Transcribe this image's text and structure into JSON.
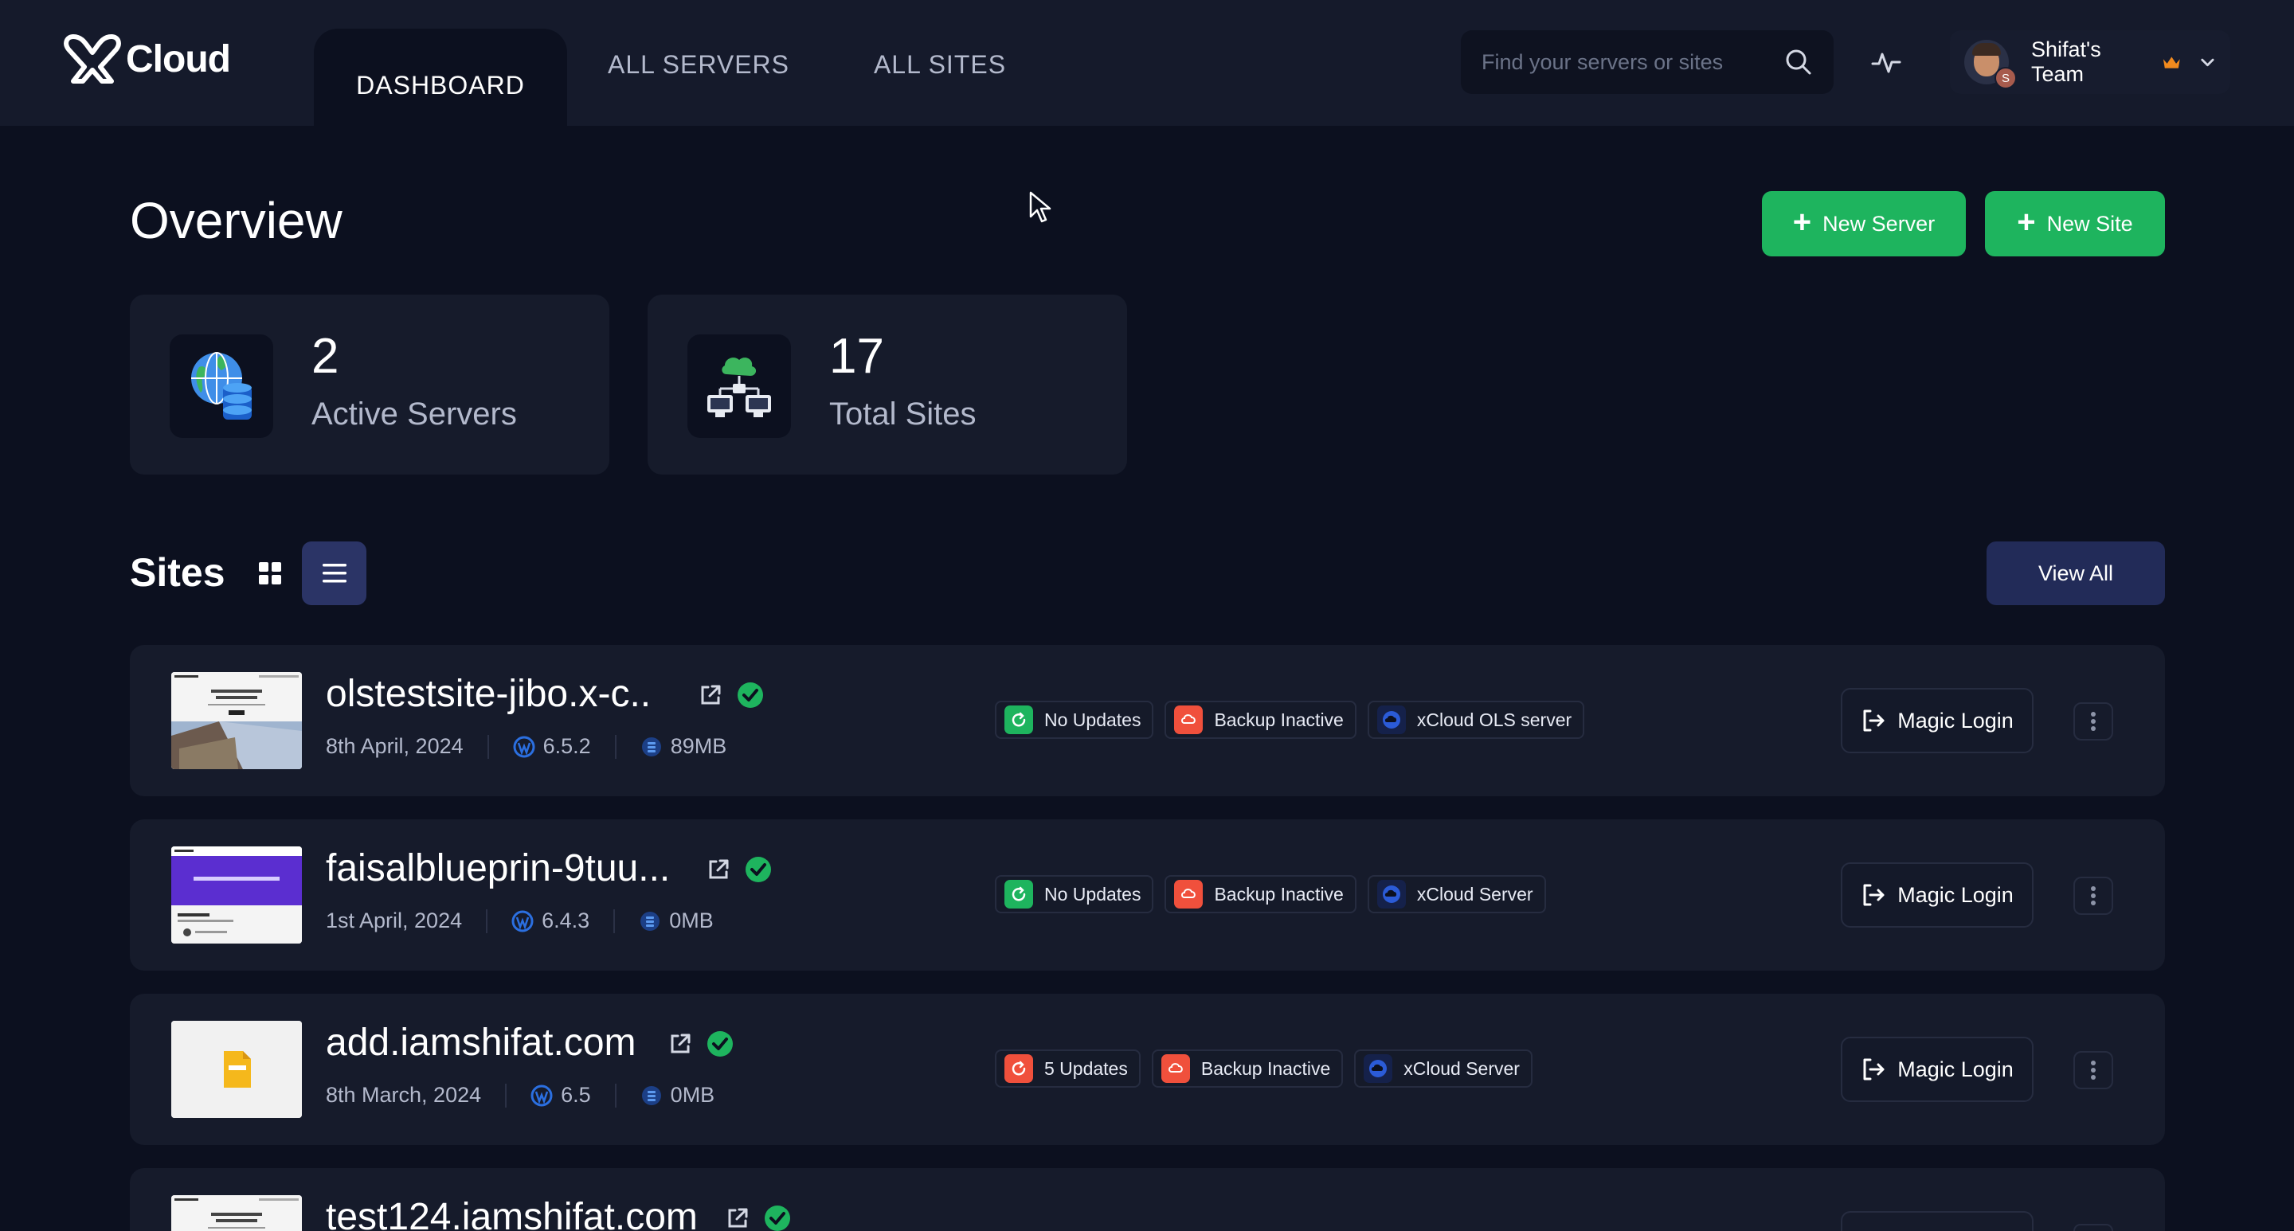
{
  "brand": {
    "name": "Cloud"
  },
  "nav": {
    "tabs": [
      {
        "label": "DASHBOARD",
        "active": true
      },
      {
        "label": "ALL SERVERS",
        "active": false
      },
      {
        "label": "ALL SITES",
        "active": false
      }
    ]
  },
  "search": {
    "placeholder": "Find your servers or sites",
    "icon": "search-icon"
  },
  "team": {
    "name": "Shifat's Team",
    "avatar_badge": "S"
  },
  "overview": {
    "title": "Overview",
    "new_server_label": "New Server",
    "new_site_label": "New Site",
    "stats": [
      {
        "value": "2",
        "label": "Active Servers",
        "icon": "globe-database-icon"
      },
      {
        "value": "17",
        "label": "Total Sites",
        "icon": "cloud-network-icon"
      }
    ]
  },
  "sites": {
    "title": "Sites",
    "view_all_label": "View All",
    "magic_login_label": "Magic Login",
    "items": [
      {
        "name": "olstestsite-jibo.x-c..",
        "date": "8th April, 2024",
        "wp_version": "6.5.2",
        "size": "89MB",
        "updates": "No Updates",
        "updates_status": "ok",
        "backup": "Backup Inactive",
        "server": "xCloud OLS server"
      },
      {
        "name": "faisalblueprin-9tuu...",
        "date": "1st April, 2024",
        "wp_version": "6.4.3",
        "size": "0MB",
        "updates": "No Updates",
        "updates_status": "ok",
        "backup": "Backup Inactive",
        "server": "xCloud Server"
      },
      {
        "name": "add.iamshifat.com",
        "date": "8th March, 2024",
        "wp_version": "6.5",
        "size": "0MB",
        "updates": "5 Updates",
        "updates_status": "pending",
        "backup": "Backup Inactive",
        "server": "xCloud Server"
      },
      {
        "name": "test124.iamshifat.com"
      }
    ]
  },
  "colors": {
    "bg": "#0c101f",
    "card": "#161b2b",
    "green": "#1eb45e",
    "red": "#f0503c",
    "blue": "#2b5bd7",
    "navy": "#222b58"
  }
}
